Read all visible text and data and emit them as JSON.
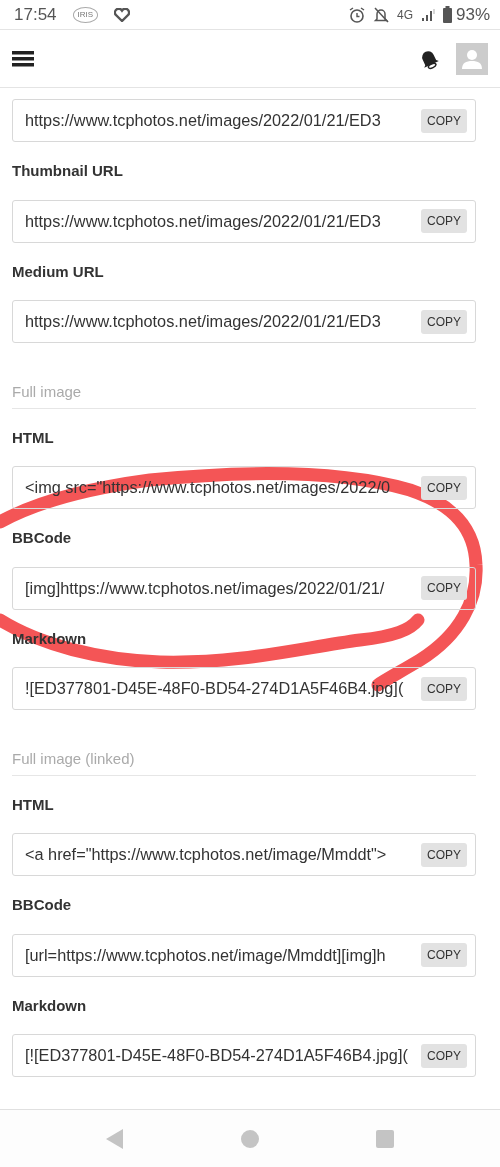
{
  "status_bar": {
    "time": "17:54",
    "app_badge": "IRIS",
    "network": "4G",
    "battery": "93%"
  },
  "sections": [
    {
      "fields": [
        {
          "value": "https://www.tcphotos.net/images/2022/01/21/ED3",
          "button": "COPY"
        },
        {
          "label": "Thumbnail URL",
          "value": "https://www.tcphotos.net/images/2022/01/21/ED3",
          "button": "COPY"
        },
        {
          "label": "Medium URL",
          "value": "https://www.tcphotos.net/images/2022/01/21/ED3",
          "button": "COPY"
        }
      ]
    },
    {
      "heading": "Full image",
      "fields": [
        {
          "label": "HTML",
          "value": "<img src=\"https://www.tcphotos.net/images/2022/0",
          "button": "COPY"
        },
        {
          "label": "BBCode",
          "value": "[img]https://www.tcphotos.net/images/2022/01/21/",
          "button": "COPY"
        },
        {
          "label": "Markdown",
          "value": "![ED377801-D45E-48F0-BD54-274D1A5F46B4.jpg](",
          "button": "COPY"
        }
      ]
    },
    {
      "heading": "Full image (linked)",
      "fields": [
        {
          "label": "HTML",
          "value": "<a href=\"https://www.tcphotos.net/image/Mmddt\">",
          "button": "COPY"
        },
        {
          "label": "BBCode",
          "value": "[url=https://www.tcphotos.net/image/Mmddt][img]h",
          "button": "COPY"
        },
        {
          "label": "Markdown",
          "value": "[![ED377801-D45E-48F0-BD54-274D1A5F46B4.jpg](",
          "button": "COPY"
        }
      ]
    }
  ]
}
